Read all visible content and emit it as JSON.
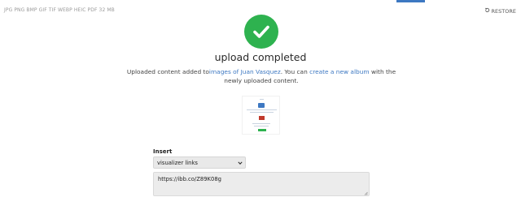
{
  "header": {
    "formats": "JPG PNG BMP GIF TIF WEBP HEIC PDF   32 MB",
    "restore_label": "RESTORE"
  },
  "result": {
    "title": "upload completed",
    "message_prefix": "Uploaded content added to",
    "album_link": "images of Juan Vasquez",
    "message_middle": ". You can ",
    "create_link": "create a new album",
    "message_suffix": " with the newly uploaded content."
  },
  "insert": {
    "label": "Insert",
    "selected_option": "visualizer links",
    "value": "https://ibb.co/Z89K08g"
  },
  "colors": {
    "success": "#2eb24f",
    "link": "#3d78c2"
  }
}
